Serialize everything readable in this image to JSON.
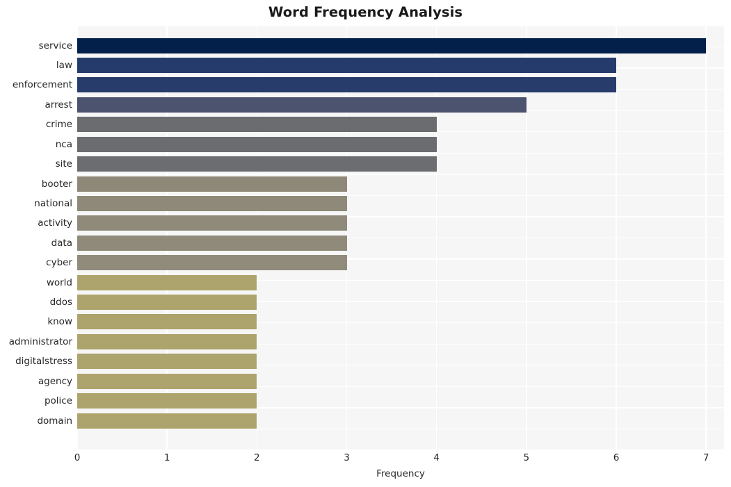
{
  "chart_data": {
    "type": "bar",
    "orientation": "horizontal",
    "title": "Word Frequency Analysis",
    "xlabel": "Frequency",
    "ylabel": "",
    "categories": [
      "service",
      "law",
      "enforcement",
      "arrest",
      "crime",
      "nca",
      "site",
      "booter",
      "national",
      "activity",
      "data",
      "cyber",
      "world",
      "ddos",
      "know",
      "administrator",
      "digitalstress",
      "agency",
      "police",
      "domain"
    ],
    "values": [
      7,
      6,
      6,
      5,
      4,
      4,
      4,
      3,
      3,
      3,
      3,
      3,
      2,
      2,
      2,
      2,
      2,
      2,
      2,
      2
    ],
    "bar_colors": [
      "#03204a",
      "#243b6b",
      "#283c6c",
      "#4b536e",
      "#6b6c6f",
      "#6b6c6f",
      "#6c6d70",
      "#8d8878",
      "#8e8979",
      "#8f8a7a",
      "#8f8a7a",
      "#908b7b",
      "#ada36c",
      "#ada36c",
      "#ada36c",
      "#ada36c",
      "#ada36c",
      "#ada36c",
      "#ada36c",
      "#ada36c"
    ],
    "xlim": [
      0,
      7.2
    ],
    "x_ticks": [
      0,
      1,
      2,
      3,
      4,
      5,
      6,
      7
    ],
    "x_tick_labels": [
      "0",
      "1",
      "2",
      "3",
      "4",
      "5",
      "6",
      "7"
    ],
    "grid": true,
    "grid_color": "#ffffff",
    "plot_background": "#f6f6f6",
    "figure_background": "#ffffff",
    "legend": null
  }
}
